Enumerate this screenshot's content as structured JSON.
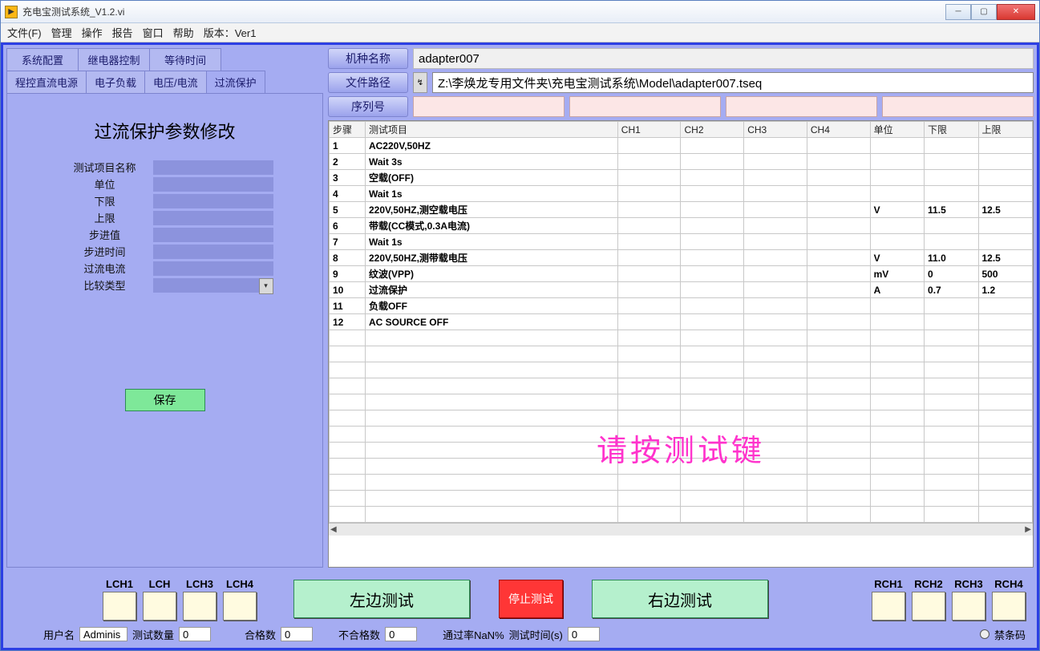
{
  "window": {
    "title": "充电宝测试系统_V1.2.vi"
  },
  "menu": [
    "文件(F)",
    "管理",
    "操作",
    "报告",
    "窗口",
    "帮助",
    "版本：Ver1"
  ],
  "left_tabs_top": [
    "系统配置",
    "继电器控制",
    "等待时间"
  ],
  "left_tabs_bot": [
    "程控直流电源",
    "电子负载",
    "电压/电流",
    "过流保护"
  ],
  "active_tab": "过流保护",
  "left_panel": {
    "heading": "过流保护参数修改",
    "fields": [
      "测试项目名称",
      "单位",
      "下限",
      "上限",
      "步进值",
      "步进时间",
      "过流电流",
      "比较类型"
    ],
    "save_label": "保存"
  },
  "info": {
    "model_label": "机种名称",
    "model_value": "adapter007",
    "path_label": "文件路径",
    "path_icon": "↯",
    "path_value": "Z:\\李焕龙专用文件夹\\充电宝测试系统\\Model\\adapter007.tseq",
    "serial_label": "序列号"
  },
  "table": {
    "headers": [
      "步骤",
      "测试项目",
      "CH1",
      "CH2",
      "CH3",
      "CH4",
      "单位",
      "下限",
      "上限"
    ],
    "rows": [
      {
        "step": "1",
        "item": "AC220V,50HZ",
        "ch1": "",
        "ch2": "",
        "ch3": "",
        "ch4": "",
        "unit": "",
        "lo": "",
        "hi": ""
      },
      {
        "step": "2",
        "item": "Wait 3s",
        "ch1": "",
        "ch2": "",
        "ch3": "",
        "ch4": "",
        "unit": "",
        "lo": "",
        "hi": ""
      },
      {
        "step": "3",
        "item": "空载(OFF)",
        "ch1": "",
        "ch2": "",
        "ch3": "",
        "ch4": "",
        "unit": "",
        "lo": "",
        "hi": ""
      },
      {
        "step": "4",
        "item": "Wait  1s",
        "ch1": "",
        "ch2": "",
        "ch3": "",
        "ch4": "",
        "unit": "",
        "lo": "",
        "hi": ""
      },
      {
        "step": "5",
        "item": "220V,50HZ,测空载电压",
        "ch1": "",
        "ch2": "",
        "ch3": "",
        "ch4": "",
        "unit": "V",
        "lo": "11.5",
        "hi": "12.5"
      },
      {
        "step": "6",
        "item": "带载(CC模式,0.3A电流)",
        "ch1": "",
        "ch2": "",
        "ch3": "",
        "ch4": "",
        "unit": "",
        "lo": "",
        "hi": ""
      },
      {
        "step": "7",
        "item": "Wait 1s",
        "ch1": "",
        "ch2": "",
        "ch3": "",
        "ch4": "",
        "unit": "",
        "lo": "",
        "hi": ""
      },
      {
        "step": "8",
        "item": "220V,50HZ,测带载电压",
        "ch1": "",
        "ch2": "",
        "ch3": "",
        "ch4": "",
        "unit": "V",
        "lo": "11.0",
        "hi": "12.5"
      },
      {
        "step": "9",
        "item": "纹波(VPP)",
        "ch1": "",
        "ch2": "",
        "ch3": "",
        "ch4": "",
        "unit": "mV",
        "lo": "0",
        "hi": "500"
      },
      {
        "step": "10",
        "item": "过流保护",
        "ch1": "",
        "ch2": "",
        "ch3": "",
        "ch4": "",
        "unit": "A",
        "lo": "0.7",
        "hi": "1.2"
      },
      {
        "step": "11",
        "item": "负载OFF",
        "ch1": "",
        "ch2": "",
        "ch3": "",
        "ch4": "",
        "unit": "",
        "lo": "",
        "hi": ""
      },
      {
        "step": "12",
        "item": "AC SOURCE OFF",
        "ch1": "",
        "ch2": "",
        "ch3": "",
        "ch4": "",
        "unit": "",
        "lo": "",
        "hi": ""
      }
    ],
    "overlay": "请按测试键"
  },
  "channels": {
    "left": [
      "LCH1",
      "LCH",
      "LCH3",
      "LCH4"
    ],
    "right": [
      "RCH1",
      "RCH2",
      "RCH3",
      "RCH4"
    ]
  },
  "buttons": {
    "left_test": "左边测试",
    "stop": "停止测试",
    "right_test": "右边测试"
  },
  "status": {
    "user_label": "用户名",
    "user_value": "Adminis",
    "count_label": "测试数量",
    "count_value": "0",
    "pass_label": "合格数",
    "pass_value": "0",
    "fail_label": "不合格数",
    "fail_value": "0",
    "rate_label": "通过率NaN%",
    "time_label": "测试时间(s)",
    "time_value": "0",
    "barcode_label": "禁条码"
  }
}
